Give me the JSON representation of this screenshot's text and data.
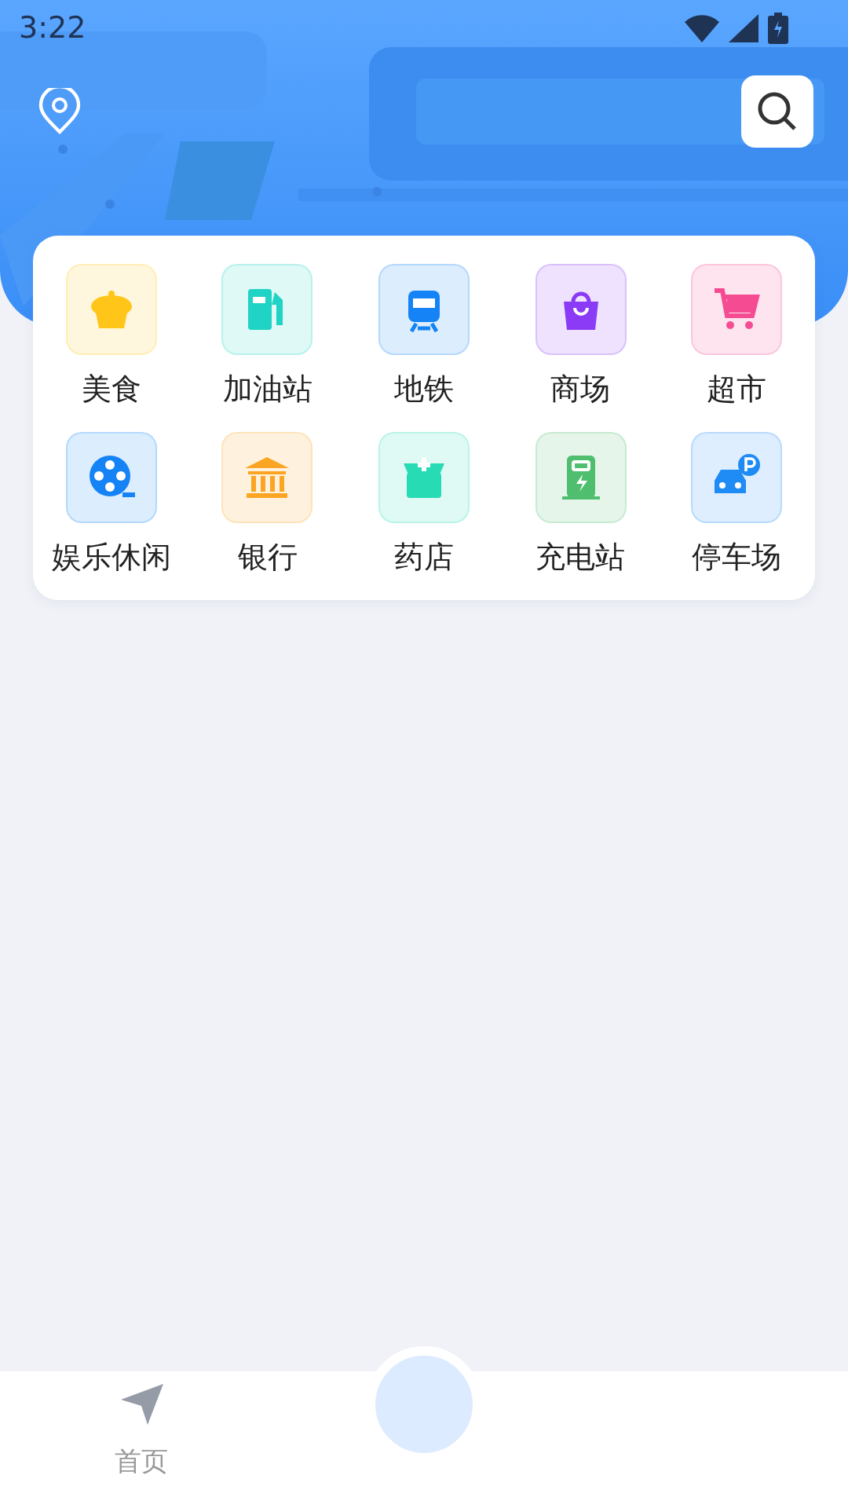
{
  "status_bar": {
    "time": "3:22"
  },
  "categories": [
    {
      "kind": "food",
      "label": "美食",
      "color": "#ffc619"
    },
    {
      "kind": "fuel",
      "label": "加油站",
      "color": "#1fd4c4"
    },
    {
      "kind": "metro",
      "label": "地铁",
      "color": "#1583f5"
    },
    {
      "kind": "mall",
      "label": "商场",
      "color": "#8b3bf5"
    },
    {
      "kind": "market",
      "label": "超市",
      "color": "#f54b93"
    },
    {
      "kind": "film",
      "label": "娱乐休闲",
      "color": "#1583f5"
    },
    {
      "kind": "bank",
      "label": "银行",
      "color": "#fba523"
    },
    {
      "kind": "pharmacy",
      "label": "药店",
      "color": "#27dbb5"
    },
    {
      "kind": "charger",
      "label": "充电站",
      "color": "#4fbf6f"
    },
    {
      "kind": "parking",
      "label": "停车场",
      "color": "#1f8bf5"
    }
  ],
  "bottom_nav": [
    {
      "kind": "nav",
      "label": "首页",
      "selected": false
    },
    {
      "kind": "center",
      "selected": true
    }
  ]
}
